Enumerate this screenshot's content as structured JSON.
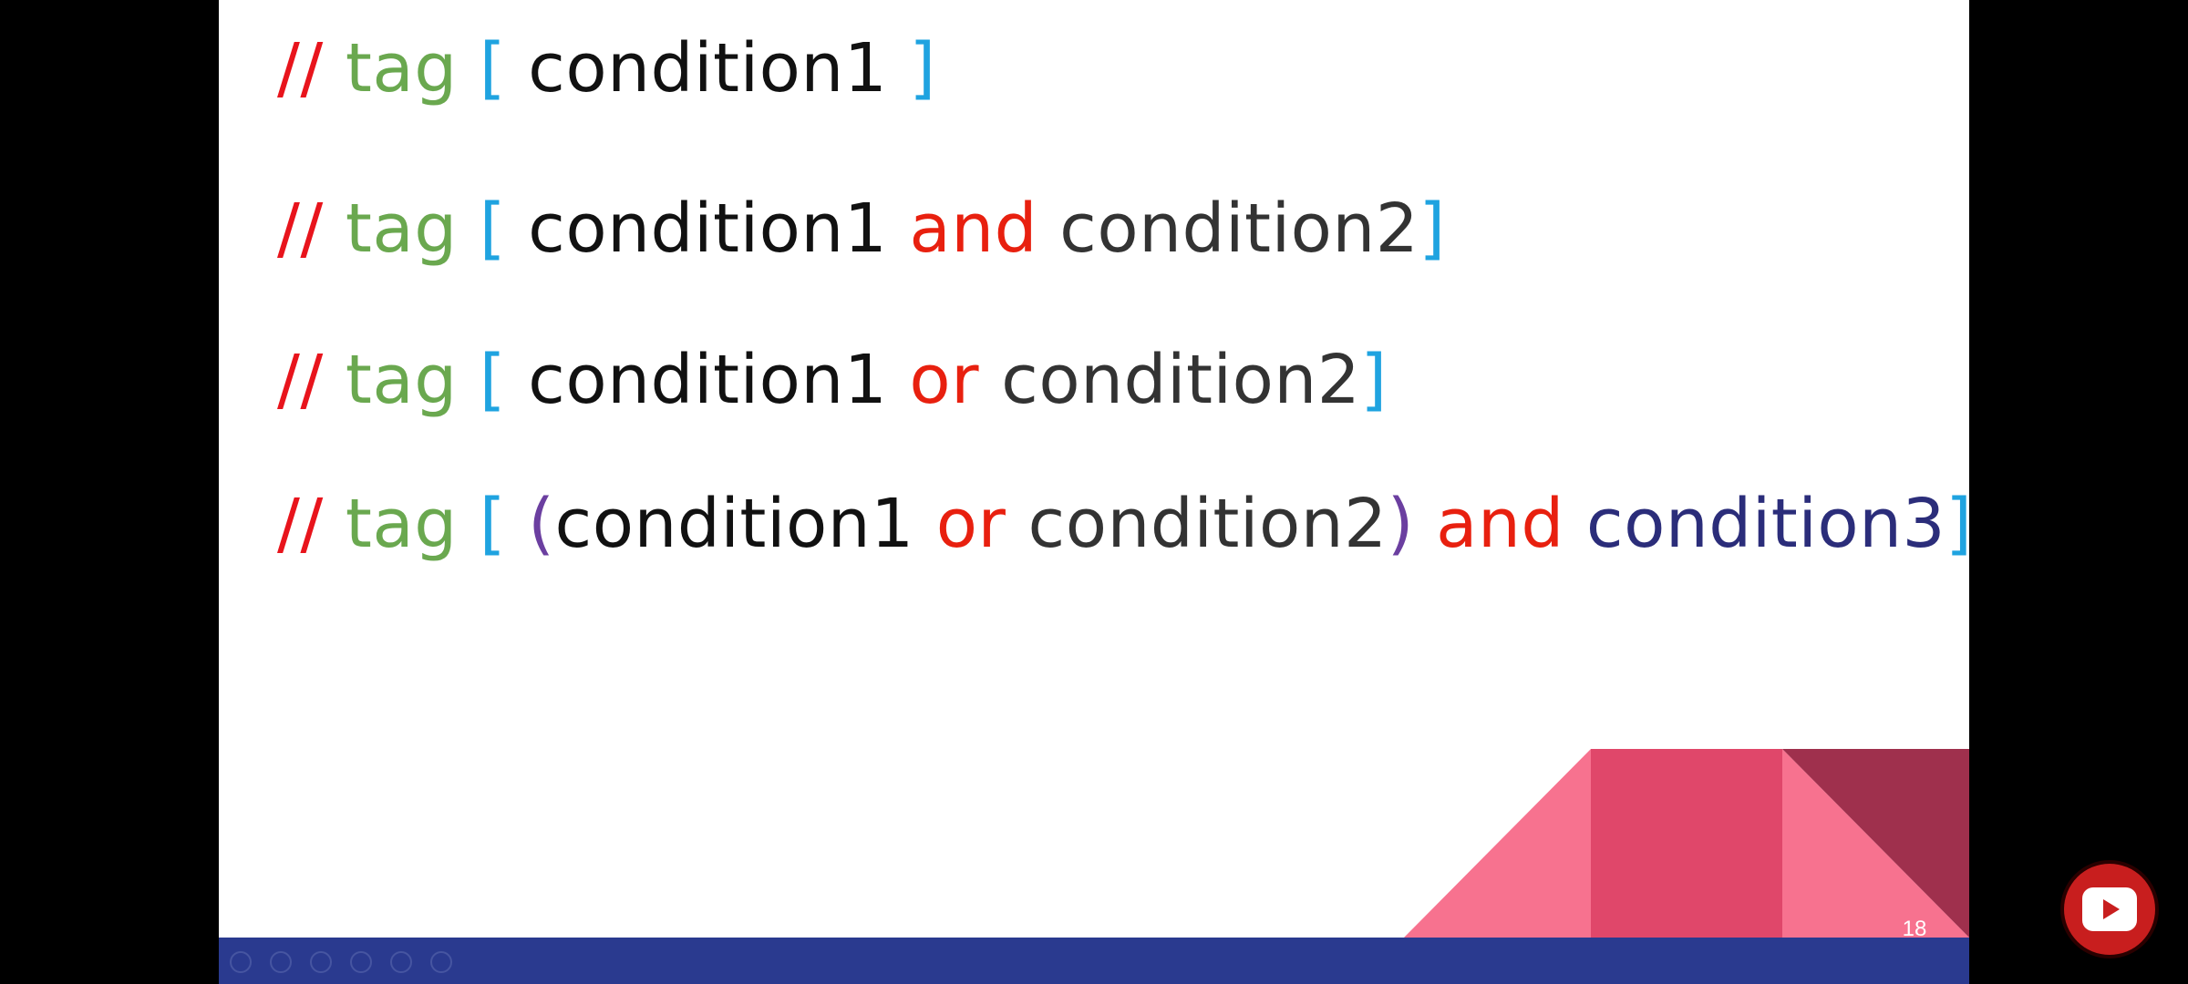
{
  "slide": {
    "lines": [
      [
        {
          "text": "// ",
          "color": "#e8141c"
        },
        {
          "text": "tag ",
          "color": "#6aa84f"
        },
        {
          "text": "[ ",
          "color": "#1fa3e0"
        },
        {
          "text": "condition1 ",
          "color": "#111111"
        },
        {
          "text": "]",
          "color": "#1fa3e0"
        }
      ],
      [
        {
          "text": "// ",
          "color": "#e8141c"
        },
        {
          "text": "tag ",
          "color": "#6aa84f"
        },
        {
          "text": "[ ",
          "color": "#1fa3e0"
        },
        {
          "text": "condition1 ",
          "color": "#111111"
        },
        {
          "text": "and ",
          "color": "#e8200f"
        },
        {
          "text": "condition2",
          "color": "#333333"
        },
        {
          "text": "]",
          "color": "#1fa3e0"
        }
      ],
      [
        {
          "text": "// ",
          "color": "#e8141c"
        },
        {
          "text": "tag ",
          "color": "#6aa84f"
        },
        {
          "text": "[ ",
          "color": "#1fa3e0"
        },
        {
          "text": "condition1 ",
          "color": "#111111"
        },
        {
          "text": "or ",
          "color": "#e8200f"
        },
        {
          "text": "condition2",
          "color": "#333333"
        },
        {
          "text": "]",
          "color": "#1fa3e0"
        }
      ],
      [
        {
          "text": "// ",
          "color": "#e8141c"
        },
        {
          "text": "tag ",
          "color": "#6aa84f"
        },
        {
          "text": "[ ",
          "color": "#1fa3e0"
        },
        {
          "text": "(",
          "color": "#6b3fa0"
        },
        {
          "text": "condition1 ",
          "color": "#111111"
        },
        {
          "text": "or ",
          "color": "#e8200f"
        },
        {
          "text": "condition2",
          "color": "#333333"
        },
        {
          "text": ") ",
          "color": "#6b3fa0"
        },
        {
          "text": "and ",
          "color": "#e8200f"
        },
        {
          "text": "condition3",
          "color": "#2b2d7a"
        },
        {
          "text": "]",
          "color": "#1fa3e0"
        }
      ]
    ],
    "page_number": "18",
    "decor_colors": {
      "light_pink": "#f7728f",
      "mid_pink": "#e0476a",
      "dark_maroon": "#9f304d",
      "bar_blue": "#2a3a8f"
    }
  },
  "video_player": {
    "youtube_button_icon": "youtube-play-icon",
    "youtube_button_color": "#c81e1e"
  }
}
